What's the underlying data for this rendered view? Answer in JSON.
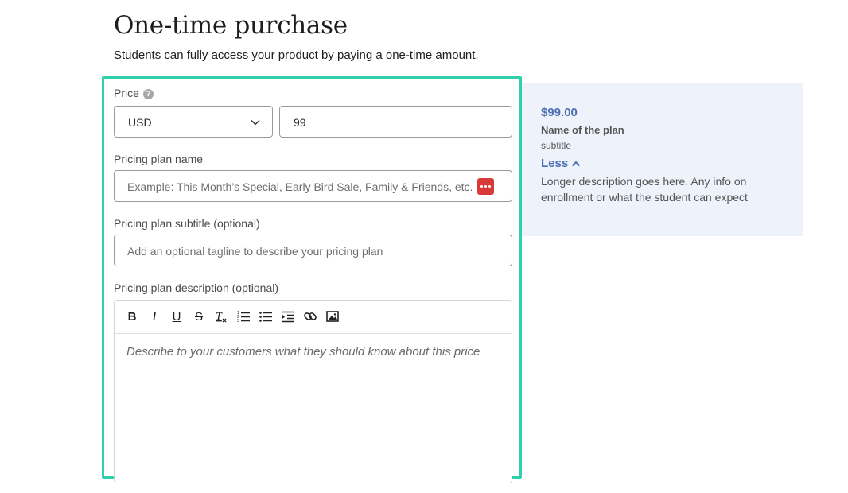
{
  "header": {
    "title": "One-time purchase",
    "subtitle": "Students can fully access your product by paying a one-time amount."
  },
  "price": {
    "label": "Price",
    "help_icon": "question-circle-icon",
    "currency_value": "USD",
    "amount_value": "99"
  },
  "plan_name": {
    "label": "Pricing plan name",
    "placeholder": "Example: This Month’s Special, Early Bird Sale, Family & Friends, etc.",
    "extension_icon": "password-manager-icon"
  },
  "plan_subtitle": {
    "label": "Pricing plan subtitle (optional)",
    "placeholder": "Add an optional tagline to describe your pricing plan"
  },
  "plan_description": {
    "label": "Pricing plan description (optional)",
    "toolbar": [
      "bold-icon",
      "italic-icon",
      "underline-icon",
      "strikethrough-icon",
      "clear-format-icon",
      "ordered-list-icon",
      "bullet-list-icon",
      "indent-icon",
      "link-icon",
      "image-icon"
    ],
    "placeholder": "Describe to your customers what they should know about this price"
  },
  "preview": {
    "price": "$99.00",
    "name": "Name of the plan",
    "subtitle": "subtitle",
    "toggle_label": "Less",
    "description": "Longer description goes here. Any info on enrollment or what the student can expect"
  },
  "colors": {
    "highlight_border": "#2fd1ad",
    "preview_bg": "#eef3fb",
    "preview_accent": "#4f6fb3"
  }
}
